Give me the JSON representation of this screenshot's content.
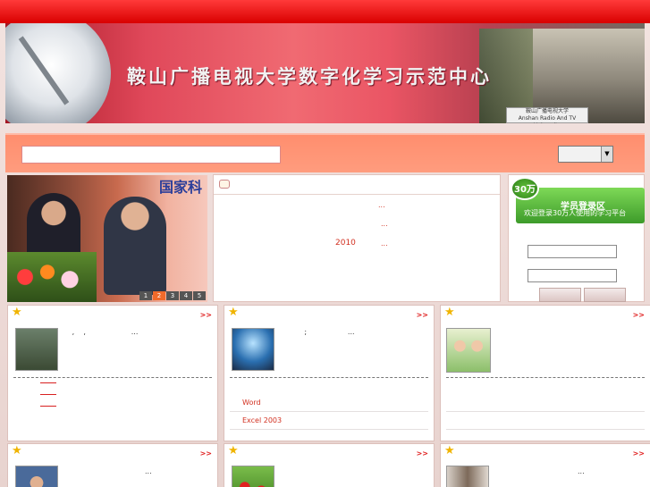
{
  "header": {
    "title": "鞍山广播电视大学数字化学习示范中心",
    "sign_line1": "鞍山广播电视大学",
    "sign_line2": "Anshan Radio And TV University"
  },
  "search": {
    "input_value": "",
    "select_value": ""
  },
  "slider": {
    "sign_text": "国家科",
    "pages": [
      "1",
      "2",
      "3",
      "4",
      "5"
    ],
    "active_page": "2"
  },
  "news": {
    "rows": [
      "...",
      "...",
      "..."
    ],
    "year": "2010"
  },
  "login": {
    "badge": "30万",
    "title": "学员登录区",
    "subtitle": "欢迎登录30万人使用的学习平台"
  },
  "cards": [
    {
      "more": ">>",
      "desc": "   ,    ,                    ..."
    },
    {
      "more": ">>",
      "desc": "          ;                  ...",
      "list": [
        "Word",
        "Excel 2003"
      ]
    },
    {
      "more": ">>",
      "desc": ""
    },
    {
      "more": ">>",
      "desc": "                                   ..."
    },
    {
      "more": ">>",
      "desc": ""
    },
    {
      "more": ">>",
      "desc": "                                   ..."
    }
  ],
  "colors": {
    "header_red": "#d90000",
    "search_bar": "#ff9c7e",
    "link_red": "#d23020",
    "login_green": "#3d9b2a"
  }
}
